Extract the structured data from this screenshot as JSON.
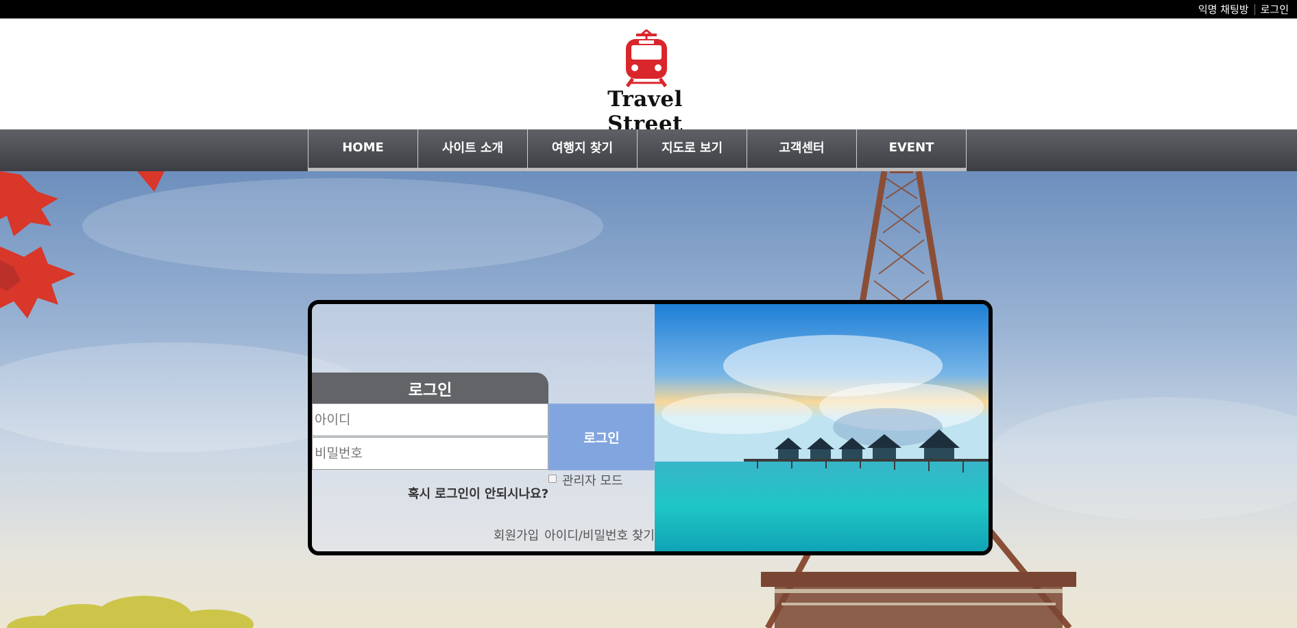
{
  "topbar": {
    "links": [
      "익명 채팅방",
      "로그인"
    ]
  },
  "brand": {
    "name": "Travel Street",
    "logo_color": "#d9262b"
  },
  "nav": {
    "items": [
      "HOME",
      "사이트 소개",
      "여행지 찾기",
      "지도로 보기",
      "고객센터",
      "EVENT"
    ]
  },
  "login": {
    "title": "로그인",
    "id_placeholder": "아이디",
    "pw_placeholder": "비밀번호",
    "submit_label": "로그인",
    "admin_label": "관리자 모드",
    "trouble_text": "혹시 로그인이 안되시나요?",
    "signup_link": "회원가입",
    "find_link": "아이디/비밀번호 찾기"
  },
  "colors": {
    "login_button": "#81a5df",
    "login_tab": "#626468",
    "nav_bg": "#4a4c51"
  }
}
